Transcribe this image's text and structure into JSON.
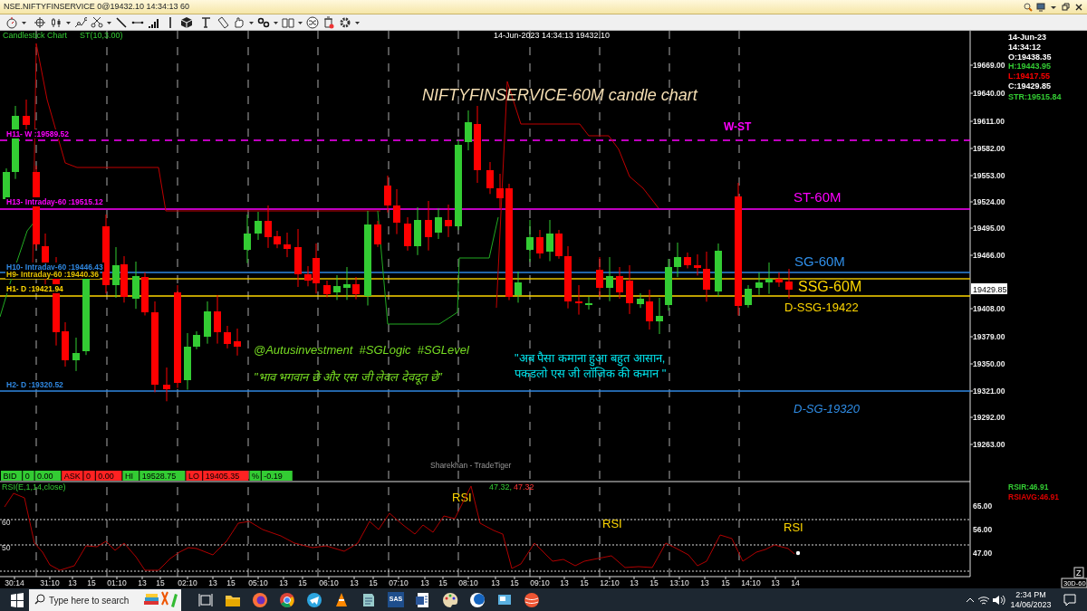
{
  "window": {
    "title": "NSE.NIFTYFINSERVICE 0@19432.10 14:34:13 60"
  },
  "chart": {
    "type_label": "Candlestick Chart",
    "indicator_label": "ST(10,3.00)",
    "cursor_info": "14-Jun-2023 14:34:13 19432.10",
    "watermark": "Sharekhan - TradeTiger",
    "last_price": "19429.85",
    "price_axis": [
      "19669.00",
      "19640.00",
      "19611.00",
      "19582.00",
      "19553.00",
      "19524.00",
      "19495.00",
      "19466.00",
      "19408.00",
      "19379.00",
      "19350.00",
      "19321.00",
      "19292.00",
      "19263.00"
    ],
    "levels": [
      {
        "label": "H11- W :19589.52",
        "color": "#ff00ff",
        "dashed": true
      },
      {
        "label": "H13- Intraday-60 :19515.12",
        "color": "#ff00ff",
        "dashed": false
      },
      {
        "label": "H10- Intraday-60 :19446.43",
        "color": "#2f87e0",
        "dashed": false
      },
      {
        "label": "H9- Intraday-60 :19440.36",
        "color": "#e6c200",
        "dashed": false
      },
      {
        "label": "H1- D :19421.94",
        "color": "#ffd700",
        "dashed": false
      },
      {
        "label": "H2- D :19320.52",
        "color": "#2f87e0",
        "dashed": false
      }
    ],
    "annotations": [
      {
        "text": "NIFTYFINSERVICE-60M candle chart",
        "color": "#f5deb3",
        "italic": true,
        "bold": false
      },
      {
        "text": "W-ST",
        "color": "#ff00ff",
        "italic": false,
        "bold": true
      },
      {
        "text": "ST-60M",
        "color": "#ff00ff",
        "italic": false,
        "bold": false
      },
      {
        "text": "SG-60M",
        "color": "#2f8ee8",
        "italic": false,
        "bold": false
      },
      {
        "text": "SSG-60M",
        "color": "#ffd700",
        "italic": false,
        "bold": false
      },
      {
        "text": "D-SSG-19422",
        "color": "#ffd700",
        "italic": false,
        "bold": false
      },
      {
        "text": "D-SG-19320",
        "color": "#2f8ee8",
        "italic": true,
        "bold": false
      },
      {
        "text": "@Autusinvestment  #SGLogic  #SGLevel",
        "color": "#77dd22",
        "italic": true,
        "bold": false
      },
      {
        "text": "\"भाव भगवान छे और एस जी लेवल देवदूत छे”",
        "color": "#77dd22",
        "italic": true,
        "bold": false
      },
      {
        "text": "\"अब पैसा कमाना हुआ बहुत आसान,",
        "color": "#00e5ee",
        "italic": false,
        "bold": false
      },
      {
        "text": "पकडलो एस जी लॉजिक की कमान \"",
        "color": "#00e5ee",
        "italic": false,
        "bold": false
      }
    ],
    "info": [
      {
        "text": "14-Jun-23",
        "color": "#ffffff"
      },
      {
        "text": "14:34:12",
        "color": "#ffffff"
      },
      {
        "text": "O:19438.35",
        "color": "#ffffff"
      },
      {
        "text": "H:19443.95",
        "color": "#33cc33"
      },
      {
        "text": "L:19417.55",
        "color": "#ff0000"
      },
      {
        "text": "C:19429.85",
        "color": "#ffffff"
      },
      {
        "text": "STR:19515.84",
        "color": "#33cc33"
      }
    ],
    "quote_strip": [
      {
        "text": "BID",
        "color": "#33cc33"
      },
      {
        "text": "0",
        "color": "#33cc33"
      },
      {
        "text": "0.00",
        "color": "#33cc33"
      },
      {
        "text": "ASK",
        "color": "#ff2222"
      },
      {
        "text": "0",
        "color": "#ff2222"
      },
      {
        "text": "0.00",
        "color": "#ff2222"
      },
      {
        "text": "HI",
        "color": "#33cc33"
      },
      {
        "text": "19528.75",
        "color": "#33cc33"
      },
      {
        "text": "LO",
        "color": "#ff2222"
      },
      {
        "text": "19405.35",
        "color": "#ff2222"
      },
      {
        "text": "%",
        "color": "#33cc33"
      },
      {
        "text": "-0.19",
        "color": "#33cc33"
      }
    ]
  },
  "rsi": {
    "label": "RSI(E,1,14,close)",
    "value_a": "47.32,",
    "value_b": "47.32",
    "left_axis": [
      "60",
      "50"
    ],
    "right_axis": [
      "65.00",
      "56.00",
      "47.00"
    ],
    "marks": [
      "RSI",
      "RSI",
      "RSI"
    ],
    "info": [
      {
        "text": "RSIR:46.91",
        "color": "#33cc33"
      },
      {
        "text": "RSIAVG:46.91",
        "color": "#dd0000"
      }
    ]
  },
  "time_axis": [
    "30:14",
    "31:10",
    "13",
    "15",
    "01:10",
    "13",
    "15",
    "02:10",
    "13",
    "15",
    "05:10",
    "13",
    "15",
    "06:10",
    "13",
    "15",
    "07:10",
    "13",
    "15",
    "08:10",
    "13",
    "15",
    "09:10",
    "13",
    "15",
    "12:10",
    "13",
    "15",
    "13:10",
    "13",
    "15",
    "14:10",
    "13",
    "14"
  ],
  "corner": {
    "zoom": "Z",
    "period": "30D-60"
  },
  "taskbar": {
    "search_placeholder": "Type here to search",
    "sas": "SAS",
    "time": "2:34 PM",
    "date": "14/06/2023"
  }
}
